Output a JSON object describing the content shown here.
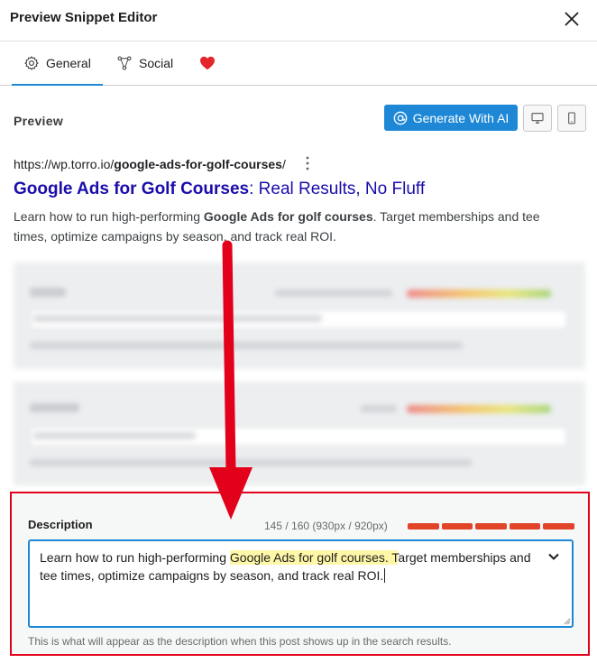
{
  "header": {
    "title": "Preview Snippet Editor"
  },
  "tabs": [
    {
      "label": "General"
    },
    {
      "label": "Social"
    },
    {
      "label": ""
    }
  ],
  "preview": {
    "label": "Preview",
    "generate_button": "Generate With AI"
  },
  "serp": {
    "url_prefix": "https://wp.torro.io/",
    "url_slug": "google-ads-for-golf-courses",
    "url_suffix": "/",
    "title_bold": "Google Ads for Golf Courses",
    "title_rest": ": Real Results, No Fluff",
    "desc_start": "Learn how to run high-performing ",
    "desc_bold": "Google Ads for golf courses",
    "desc_end": ". Target memberships and tee times, optimize campaigns by season, and track real ROI."
  },
  "description_field": {
    "label": "Description",
    "count": "145 / 160 (930px / 920px)",
    "value_start": "Learn how to run high-performing ",
    "value_highlight": "Google Ads for golf courses. T",
    "value_end": "arget memberships and tee times, optimize campaigns by season, and track real ROI.",
    "help": "This is what will appear as the description when this post shows up in the search results.",
    "meter_fraction": 1.0
  },
  "colors": {
    "accent": "#1e88d7",
    "serp_title": "#1a0dab",
    "annotation_red": "#e3001b",
    "meter_red": "#e14428",
    "highlight": "#fff7a8",
    "heart": "#e3262b"
  }
}
